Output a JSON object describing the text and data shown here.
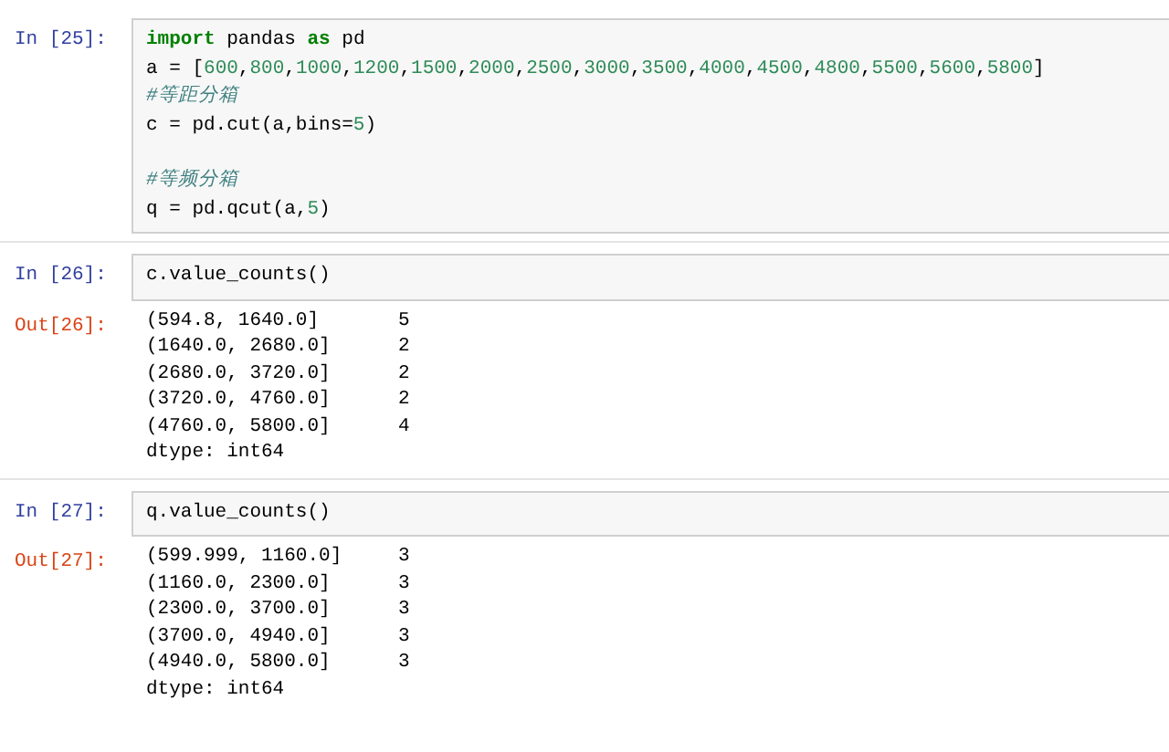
{
  "cells": [
    {
      "in_prompt": "In [25]:",
      "blocks": [
        [
          [
            {
              "kind": "keyword",
              "text": "import"
            },
            {
              "kind": "plain",
              "text": " pandas "
            },
            {
              "kind": "keyword",
              "text": "as"
            },
            {
              "kind": "plain",
              "text": " pd"
            }
          ],
          [
            {
              "kind": "plain",
              "text": "a = ["
            },
            {
              "kind": "number",
              "text": "600"
            },
            {
              "kind": "plain",
              "text": ","
            },
            {
              "kind": "number",
              "text": "800"
            },
            {
              "kind": "plain",
              "text": ","
            },
            {
              "kind": "number",
              "text": "1000"
            },
            {
              "kind": "plain",
              "text": ","
            },
            {
              "kind": "number",
              "text": "1200"
            },
            {
              "kind": "plain",
              "text": ","
            },
            {
              "kind": "number",
              "text": "1500"
            },
            {
              "kind": "plain",
              "text": ","
            },
            {
              "kind": "number",
              "text": "2000"
            },
            {
              "kind": "plain",
              "text": ","
            },
            {
              "kind": "number",
              "text": "2500"
            },
            {
              "kind": "plain",
              "text": ","
            },
            {
              "kind": "number",
              "text": "3000"
            },
            {
              "kind": "plain",
              "text": ","
            },
            {
              "kind": "number",
              "text": "3500"
            },
            {
              "kind": "plain",
              "text": ","
            },
            {
              "kind": "number",
              "text": "4000"
            },
            {
              "kind": "plain",
              "text": ","
            },
            {
              "kind": "number",
              "text": "4500"
            },
            {
              "kind": "plain",
              "text": ","
            },
            {
              "kind": "number",
              "text": "4800"
            },
            {
              "kind": "plain",
              "text": ","
            },
            {
              "kind": "number",
              "text": "5500"
            },
            {
              "kind": "plain",
              "text": ","
            },
            {
              "kind": "number",
              "text": "5600"
            },
            {
              "kind": "plain",
              "text": ","
            },
            {
              "kind": "number",
              "text": "5800"
            },
            {
              "kind": "plain",
              "text": "]"
            }
          ],
          [
            {
              "kind": "comment",
              "text": "#等距分箱"
            }
          ],
          [
            {
              "kind": "plain",
              "text": "c = pd.cut(a,bins="
            },
            {
              "kind": "number",
              "text": "5"
            },
            {
              "kind": "plain",
              "text": ")"
            }
          ]
        ],
        [
          [
            {
              "kind": "comment",
              "text": "#等频分箱"
            }
          ],
          [
            {
              "kind": "plain",
              "text": "q = pd.qcut(a,"
            },
            {
              "kind": "number",
              "text": "5"
            },
            {
              "kind": "plain",
              "text": ")"
            }
          ]
        ]
      ]
    },
    {
      "in_prompt": "In [26]:",
      "blocks": [
        [
          [
            {
              "kind": "plain",
              "text": "c.value_counts()"
            }
          ]
        ]
      ],
      "out_prompt": "Out[26]:",
      "output_rows": [
        {
          "interval": "(594.8, 1640.0]",
          "count": "5"
        },
        {
          "interval": "(1640.0, 2680.0]",
          "count": "2"
        },
        {
          "interval": "(2680.0, 3720.0]",
          "count": "2"
        },
        {
          "interval": "(3720.0, 4760.0]",
          "count": "2"
        },
        {
          "interval": "(4760.0, 5800.0]",
          "count": "4"
        }
      ],
      "dtype": "dtype: int64"
    },
    {
      "in_prompt": "In [27]:",
      "blocks": [
        [
          [
            {
              "kind": "plain",
              "text": "q.value_counts()"
            }
          ]
        ]
      ],
      "out_prompt": "Out[27]:",
      "output_rows": [
        {
          "interval": "(599.999, 1160.0]",
          "count": "3"
        },
        {
          "interval": "(1160.0, 2300.0]",
          "count": "3"
        },
        {
          "interval": "(2300.0, 3700.0]",
          "count": "3"
        },
        {
          "interval": "(3700.0, 4940.0]",
          "count": "3"
        },
        {
          "interval": "(4940.0, 5800.0]",
          "count": "3"
        }
      ],
      "dtype": "dtype: int64"
    }
  ]
}
